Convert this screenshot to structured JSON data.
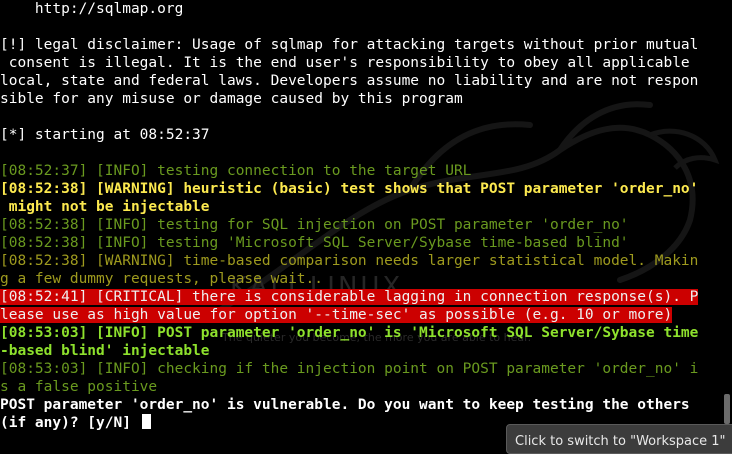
{
  "terminal": {
    "lines": [
      {
        "text": "    http://sqlmap.org",
        "style": "white"
      },
      {
        "text": "",
        "style": "white"
      },
      {
        "text": "[!] legal disclaimer: Usage of sqlmap for attacking targets without prior mutual",
        "style": "white"
      },
      {
        "text": " consent is illegal. It is the end user's responsibility to obey all applicable",
        "style": "white"
      },
      {
        "text": "local, state and federal laws. Developers assume no liability and are not respon",
        "style": "white"
      },
      {
        "text": "sible for any misuse or damage caused by this program",
        "style": "white"
      },
      {
        "text": "",
        "style": "white"
      },
      {
        "text": "[*] starting at 08:52:37",
        "style": "white"
      },
      {
        "text": "",
        "style": "white"
      },
      {
        "text": "[08:52:37] [INFO] testing connection to the target URL",
        "style": "green"
      },
      {
        "text": "[08:52:38] [WARNING] heuristic (basic) test shows that POST parameter 'order_no'",
        "style": "yellow-bold"
      },
      {
        "text": " might not be injectable",
        "style": "yellow-bold"
      },
      {
        "text": "[08:52:38] [INFO] testing for SQL injection on POST parameter 'order_no'",
        "style": "green"
      },
      {
        "text": "[08:52:38] [INFO] testing 'Microsoft SQL Server/Sybase time-based blind'",
        "style": "green"
      },
      {
        "text": "[08:52:38] [WARNING] time-based comparison needs larger statistical model. Makin",
        "style": "yellow"
      },
      {
        "text": "g a few dummy requests, please wait..",
        "style": "yellow"
      },
      {
        "text": "[08:52:41] [CRITICAL] there is considerable lagging in connection response(s). P",
        "style": "crit"
      },
      {
        "text": "lease use as high value for option '--time-sec' as possible (e.g. 10 or more)",
        "style": "crit"
      },
      {
        "text": "[08:53:03] [INFO] POST parameter 'order_no' is 'Microsoft SQL Server/Sybase time",
        "style": "green-bold"
      },
      {
        "text": "-based blind' injectable",
        "style": "green-bold"
      },
      {
        "text": "[08:53:03] [INFO] checking if the injection point on POST parameter 'order_no' i",
        "style": "green"
      },
      {
        "text": "s a false positive",
        "style": "green"
      },
      {
        "text": "POST parameter 'order_no' is vulnerable. Do you want to keep testing the others",
        "style": "white-bold"
      },
      {
        "text": "(if any)? [y/N] ",
        "style": "white-bold",
        "cursor": true
      }
    ]
  },
  "background": {
    "watermark_title": "KALI LINUX",
    "watermark_quote": "The quieter you become, the more you are able to hear."
  },
  "tooltip": {
    "text": "Click to switch to \"Workspace 1\""
  },
  "colors": {
    "background": "#000000",
    "info": "#6a9a1f",
    "info_bold": "#8ee12d",
    "warning": "#9e9a1e",
    "warning_bold": "#fce94f",
    "critical_bg": "#cc0000"
  }
}
